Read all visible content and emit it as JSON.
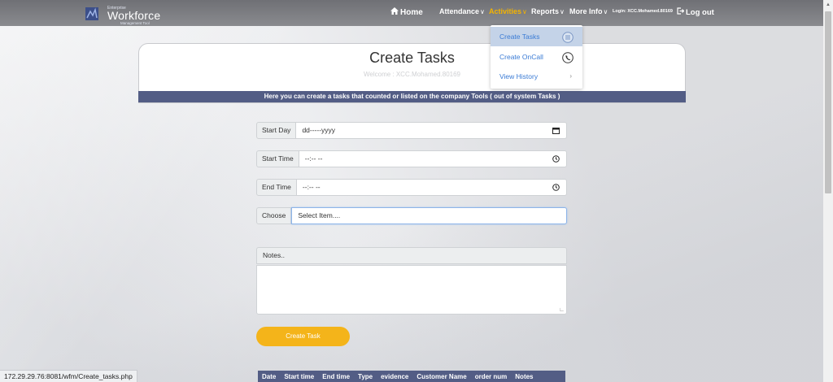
{
  "logo": {
    "small_text": "Enterprise",
    "name": "Workforce",
    "tagline": "Management Tool"
  },
  "nav": {
    "home": "Home",
    "attendance": "Attendance",
    "activities": "Activities",
    "reports": "Reports",
    "more_info": "More Info",
    "login": "Login: XCC.Mohamed.80169",
    "logout": "Log out",
    "accent_color": "#f5b400"
  },
  "dropdown": {
    "items": [
      {
        "label": "Create Tasks",
        "icon": "list-icon"
      },
      {
        "label": "Create OnCall",
        "icon": "phone-icon"
      },
      {
        "label": "View History",
        "icon": "chevron-right-icon"
      }
    ]
  },
  "card": {
    "title": "Create Tasks",
    "welcome": "Welcome : XCC.Mohamed.80169",
    "banner": "Here you can create a tasks that counted or listed on the company Tools ( out of system Tasks )"
  },
  "form": {
    "start_day_label": "Start Day",
    "start_day_value": "dd-----yyyy",
    "start_time_label": "Start Time",
    "start_time_value": "--:-- --",
    "end_time_label": "End Time",
    "end_time_value": "--:-- --",
    "choose_label": "Choose",
    "choose_value": "Select Item....",
    "notes_label": "Notes..",
    "submit_label": "Create Task",
    "button_color": "#f4b41a"
  },
  "table": {
    "columns": [
      "Date",
      "Start time",
      "End time",
      "Type",
      "evidence",
      "Customer Name",
      "order num",
      "Notes"
    ],
    "header_color": "#535d85"
  },
  "status_bar": {
    "url": "172.29.29.76:8081/wfm/Create_tasks.php"
  }
}
